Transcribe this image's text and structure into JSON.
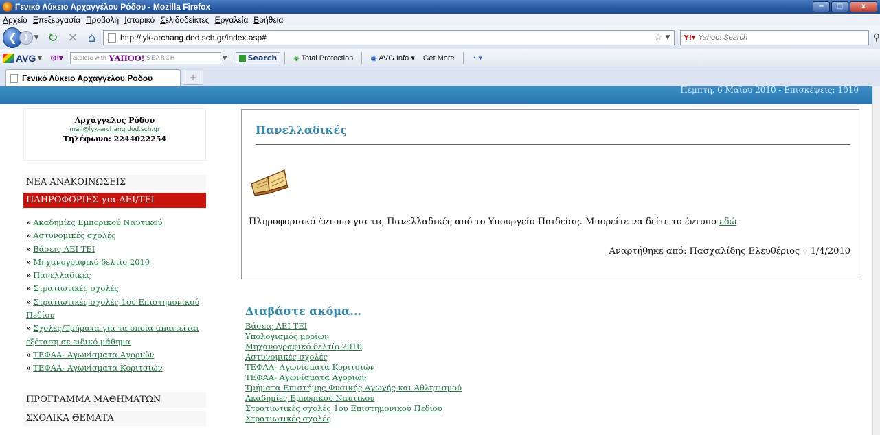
{
  "window": {
    "title": "Γενικό Λύκειο Αρχαγγέλου Ρόδου - Mozilla Firefox",
    "min": "−",
    "max": "□",
    "close": "x"
  },
  "menu": [
    "Αρχείο",
    "Επεξεργασία",
    "Προβολή",
    "Ιστορικό",
    "Σελιδοδείκτες",
    "Εργαλεία",
    "Βοήθεια"
  ],
  "nav": {
    "url": "http://lyk-archang.dod.sch.gr/index.asp#",
    "search_placeholder": "Yahoo! Search"
  },
  "avg": {
    "logo": "AVG",
    "explore": "explore with",
    "yahoo": "YAHOO!",
    "yahoo_search": "SEARCH",
    "search_btn": "Search",
    "total_protection": "Total Protection",
    "avg_info": "AVG Info",
    "get_more": "Get More"
  },
  "tab": {
    "label": "Γενικό Λύκειο Αρχαγγέλου Ρόδου",
    "newtab": "+"
  },
  "page": {
    "date_line": "Πέμπτη, 6 Μαΐου 2010 - Επισκέψεις: 1010",
    "contact": {
      "name": "Αρχάγγελος Ρόδου",
      "mail": "mail@lyk-archang.dod.sch.gr",
      "phone": "Τηλέφωνο: 2244022254"
    },
    "side": {
      "news": "ΝΕΑ ΑΝΑΚΟΙΝΩΣΕΙΣ",
      "info": "ΠΛΗΡΟΦΟΡΙΕΣ για ΑΕΙ/ΤΕΙ",
      "program": "ΠΡΟΓΡΑΜΜΑ ΜΑΘΗΜΑΤΩΝ",
      "topics": "ΣΧΟΛΙΚΑ ΘΕΜΑΤΑ",
      "bullet": "»",
      "links": [
        "Ακαδημίες Εμπορικού Ναυτικού",
        "Αστυνομικές σχολές",
        "Βάσεις ΑΕΙ ΤΕΙ",
        "Μηχανογραφικό δελτίο 2010",
        "Πανελλαδικές",
        "Στρατιωτικές σχολές",
        "Στρατιωτικές σχολές 1ου Επιστημονικού Πεδίου",
        "Σχολές/Τμήματα για τα οποία απαιτείται εξέταση σε ειδικό μάθημα",
        "ΤΕΦΑΑ- Αγωνίσματα Αγοριών",
        "ΤΕΦΑΑ- Αγωνίσματα Κοριτσιών"
      ]
    },
    "article": {
      "title": "Πανελλαδικές",
      "body": "Πληροφοριακό έντυπο για τις Πανελλαδικές από το Υπουργείο Παιδείας. Μπορείτε να δείτε το έντυπο ",
      "body_link": "εδώ",
      "body_end": ".",
      "meta_author": "Αναρτήθηκε από: Πασχαλίδης Ελευθέριος",
      "meta_date": "1/4/2010"
    },
    "more": {
      "heading": "Διαβάστε ακόμα...",
      "links": [
        "Βάσεις ΑΕΙ ΤΕΙ",
        "Υπολογισμός μορίων",
        "Μηχανογραφικό δελτίο 2010",
        "Αστυνομικές σχολές",
        "ΤΕΦΑΑ- Αγωνίσματα Κοριτσιών",
        "ΤΕΦΑΑ- Αγωνίσματα Αγοριών",
        "Τμήματα Επιστήμης Φυσικής Αγωγής και Αθλητισμού",
        "Ακαδημίες Εμπορικού Ναυτικού",
        "Στρατιωτικές σχολές 1ου Επιστημονικού Πεδίου",
        "Στρατιωτικές σχολές"
      ]
    }
  }
}
